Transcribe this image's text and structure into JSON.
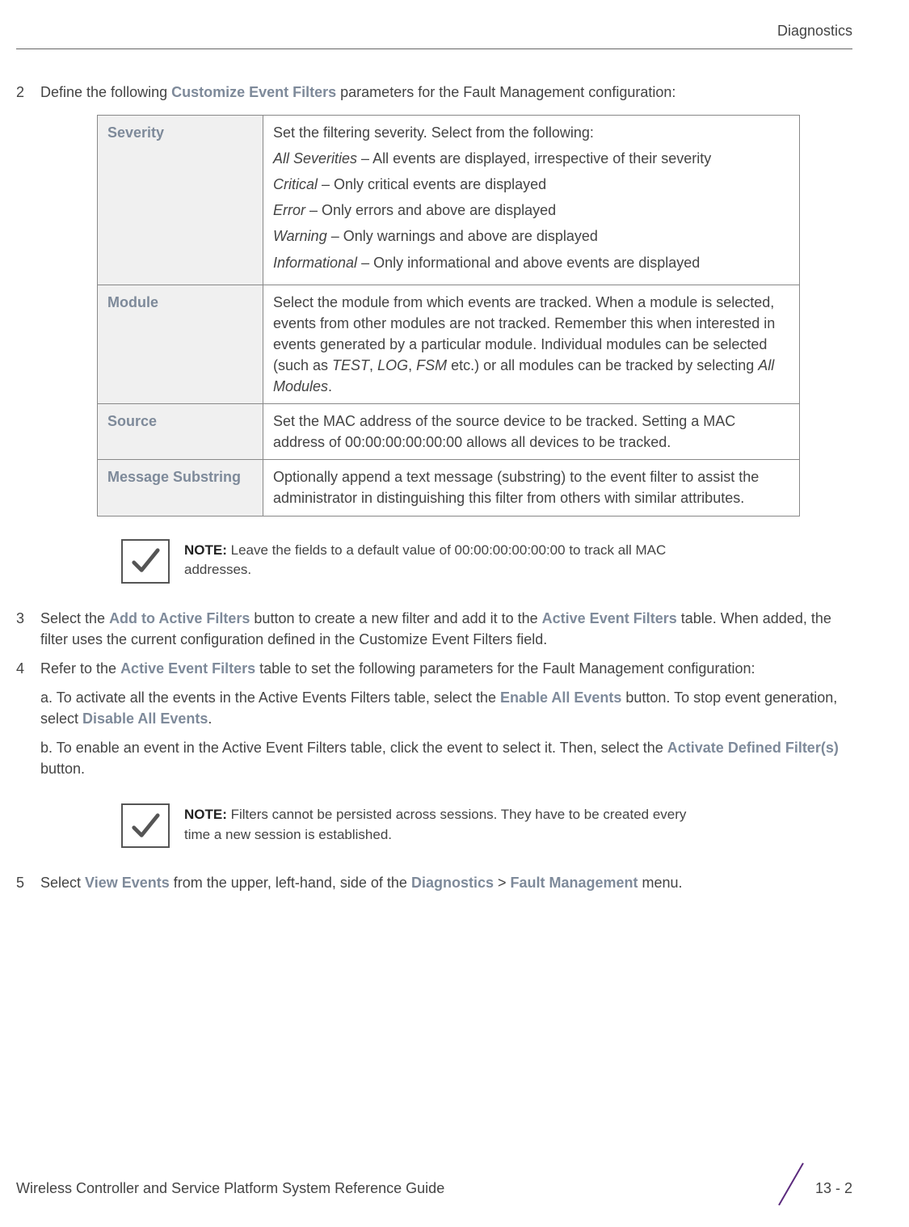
{
  "header": {
    "section": "Diagnostics"
  },
  "step2": {
    "num": "2",
    "text_before": "Define the following ",
    "emph": "Customize Event Filters",
    "text_after": " parameters for the Fault Management configuration:"
  },
  "table": {
    "severity": {
      "label": "Severity",
      "intro": "Set the filtering severity. Select from the following:",
      "opts": [
        {
          "name": "All Severities",
          "desc": " – All events are displayed, irrespective of their severity"
        },
        {
          "name": "Critical",
          "desc": " – Only critical events are displayed"
        },
        {
          "name": "Error",
          "desc": " – Only errors and above are displayed"
        },
        {
          "name": "Warning",
          "desc": " – Only warnings and above are displayed"
        },
        {
          "name": "Informational",
          "desc": " – Only informational and above events are displayed"
        }
      ]
    },
    "module": {
      "label": "Module",
      "desc_before": "Select the module from which events are tracked. When a module is selected, events from other modules are not tracked. Remember this when interested in events generated by a particular module. Individual modules can be selected (such as ",
      "i1": "TEST",
      "c1": ", ",
      "i2": "LOG",
      "c2": ", ",
      "i3": "FSM",
      "desc_mid": " etc.) or all modules can be tracked by selecting ",
      "i4": "All Modules",
      "desc_after": "."
    },
    "source": {
      "label": "Source",
      "desc": "Set the MAC address of the source device to be tracked. Setting a MAC address of 00:00:00:00:00:00 allows all devices to be tracked."
    },
    "msgsub": {
      "label": "Message Substring",
      "desc": "Optionally append a text message (substring) to the event filter to assist the administrator in distinguishing this filter from others with similar attributes."
    }
  },
  "note1": {
    "label": "NOTE: ",
    "text": "Leave the fields to a default value of 00:00:00:00:00:00 to track all MAC addresses."
  },
  "step3": {
    "num": "3",
    "t1": "Select the ",
    "e1": "Add to Active Filters",
    "t2": " button to create a new filter and add it to the ",
    "e2": "Active Event Filters",
    "t3": " table. When added, the filter uses the current configuration defined in the Customize Event Filters field."
  },
  "step4": {
    "num": "4",
    "t1": "Refer to the ",
    "e1": "Active Event Filters",
    "t2": " table to set the following parameters for the Fault Management configuration:",
    "a_t1": "a. To activate all the events in the Active Events Filters table, select the ",
    "a_e1": "Enable All Events",
    "a_t2": " button. To stop event generation, select ",
    "a_e2": "Disable All Events",
    "a_t3": ".",
    "b_t1": "b. To enable an event in the Active Event Filters table, click the event to select it. Then, select the ",
    "b_e1": "Activate Defined Filter(s)",
    "b_t2": " button."
  },
  "note2": {
    "label": "NOTE: ",
    "text": "Filters cannot be persisted across sessions. They have to be created every time a new session is established."
  },
  "step5": {
    "num": "5",
    "t1": "Select ",
    "e1": "View Events",
    "t2": " from the upper, left-hand, side of the ",
    "e2": "Diagnostics",
    "t3": " > ",
    "e3": "Fault Management",
    "t4": " menu."
  },
  "footer": {
    "guide": "Wireless Controller and Service Platform System Reference Guide",
    "page": "13 - 2"
  }
}
